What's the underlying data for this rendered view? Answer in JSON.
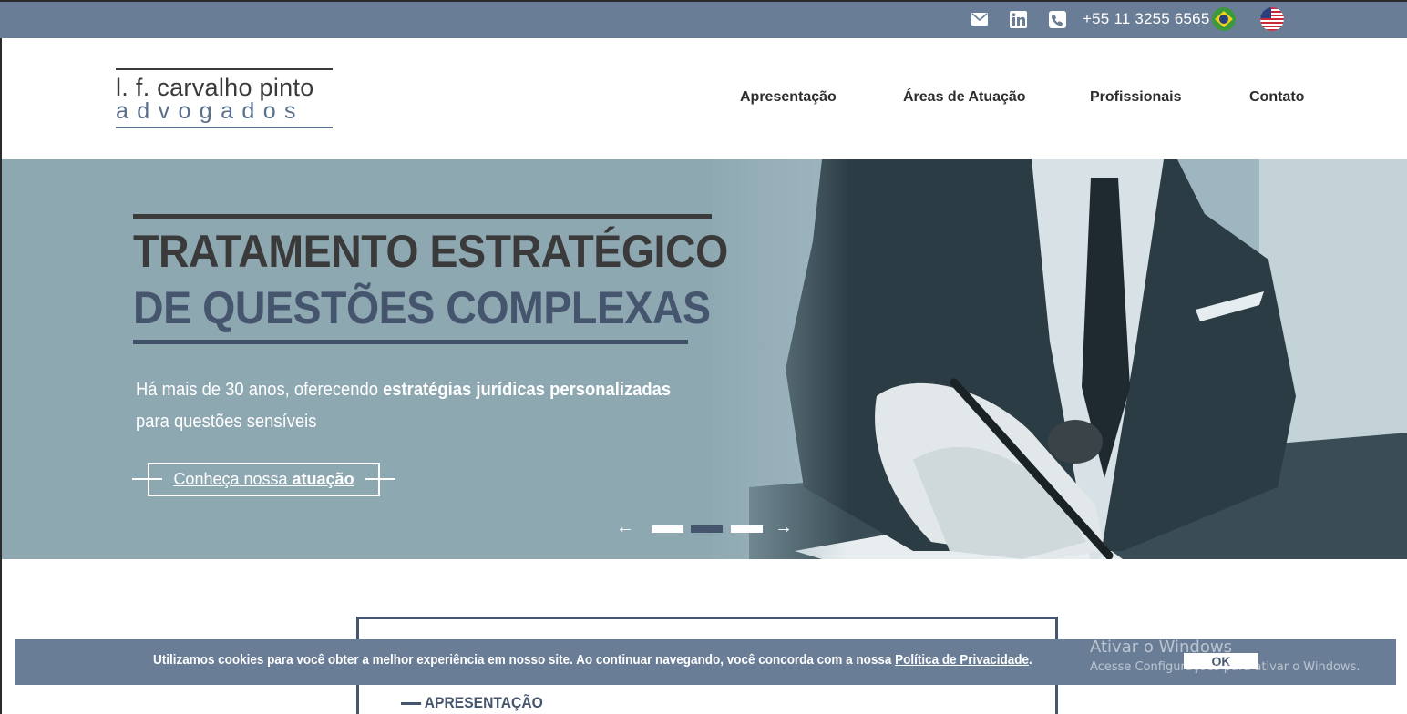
{
  "topbar": {
    "icons": [
      "envelope-icon",
      "linkedin-icon",
      "phone-icon"
    ],
    "phone": "+55 11 3255 6565",
    "flags": [
      "brazil-flag-icon",
      "usa-flag-icon"
    ]
  },
  "logo": {
    "line1": "l. f. carvalho pinto",
    "line2": "advogados"
  },
  "nav": {
    "items": [
      "Apresentação",
      "Áreas de Atuação",
      "Profissionais",
      "Contato"
    ]
  },
  "hero": {
    "title_line1": "TRATAMENTO ESTRATÉGICO",
    "title_line2": "DE QUESTÕES COMPLEXAS",
    "subtitle_part1": "Há mais de 30 anos, oferecendo ",
    "subtitle_bold": "estratégias jurídicas personalizadas",
    "subtitle_line2": "para questões sensíveis",
    "cta_text": "Conheça nossa ",
    "cta_bold": "atuação",
    "prev_arrow": "←",
    "next_arrow": "→",
    "slides": {
      "count": 3,
      "active_index": 1
    }
  },
  "section": {
    "heading": "APRESENTAÇÃO"
  },
  "cookie": {
    "text": "Utilizamos cookies para você obter a melhor experiência em nosso site. Ao continuar navegando, você concorda com a nossa ",
    "link": "Política de Privacidade",
    "end": ".",
    "ok_label": "OK"
  },
  "windows_watermark": {
    "line1": "Ativar o Windows",
    "line2": "Acesse Configurações para ativar o Windows."
  },
  "colors": {
    "topbar": "#697d96",
    "hero_bg": "#8ea8b2",
    "accent": "#45556d",
    "dark_text": "#3a3a3a"
  }
}
